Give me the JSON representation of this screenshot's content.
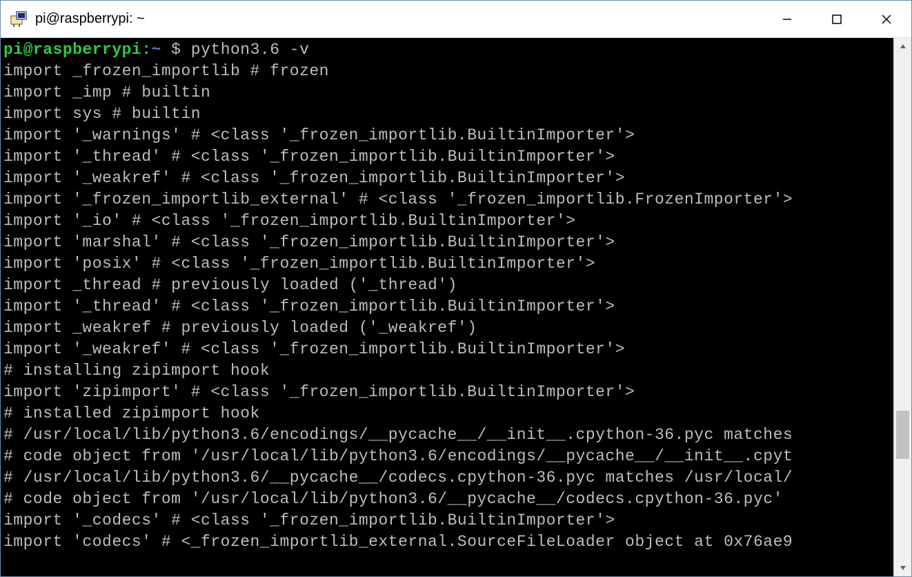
{
  "window": {
    "title": "pi@raspberrypi: ~"
  },
  "prompt": {
    "user": "pi@raspberrypi",
    "colon": ":",
    "tilde": "~",
    "dollar": " $ ",
    "command": "python3.6 -v"
  },
  "terminal": {
    "lines": [
      "import _frozen_importlib # frozen",
      "import _imp # builtin",
      "import sys # builtin",
      "import '_warnings' # <class '_frozen_importlib.BuiltinImporter'>",
      "import '_thread' # <class '_frozen_importlib.BuiltinImporter'>",
      "import '_weakref' # <class '_frozen_importlib.BuiltinImporter'>",
      "import '_frozen_importlib_external' # <class '_frozen_importlib.FrozenImporter'>",
      "import '_io' # <class '_frozen_importlib.BuiltinImporter'>",
      "import 'marshal' # <class '_frozen_importlib.BuiltinImporter'>",
      "import 'posix' # <class '_frozen_importlib.BuiltinImporter'>",
      "import _thread # previously loaded ('_thread')",
      "import '_thread' # <class '_frozen_importlib.BuiltinImporter'>",
      "import _weakref # previously loaded ('_weakref')",
      "import '_weakref' # <class '_frozen_importlib.BuiltinImporter'>",
      "# installing zipimport hook",
      "import 'zipimport' # <class '_frozen_importlib.BuiltinImporter'>",
      "# installed zipimport hook",
      "# /usr/local/lib/python3.6/encodings/__pycache__/__init__.cpython-36.pyc matches",
      "# code object from '/usr/local/lib/python3.6/encodings/__pycache__/__init__.cpyt",
      "# /usr/local/lib/python3.6/__pycache__/codecs.cpython-36.pyc matches /usr/local/",
      "# code object from '/usr/local/lib/python3.6/__pycache__/codecs.cpython-36.pyc'",
      "import '_codecs' # <class '_frozen_importlib.BuiltinImporter'>",
      "import 'codecs' # <_frozen_importlib_external.SourceFileLoader object at 0x76ae9"
    ]
  }
}
